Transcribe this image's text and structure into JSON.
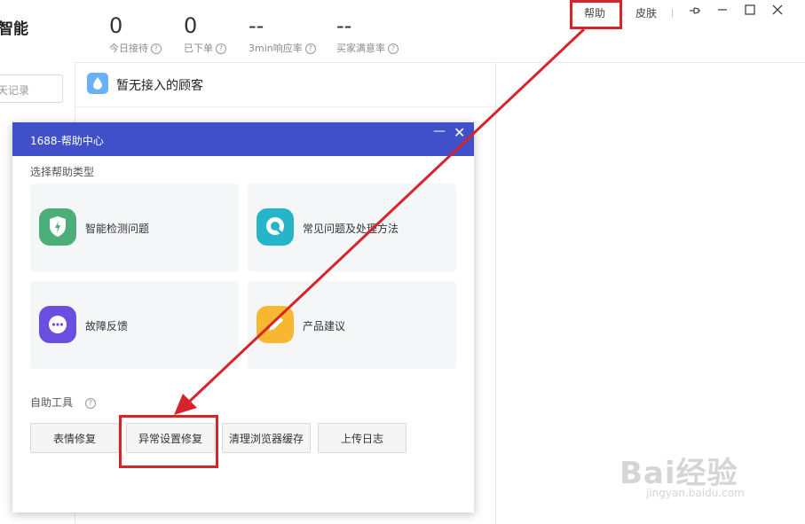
{
  "app": {
    "brand_partial": "智能"
  },
  "stats": [
    {
      "value": "0",
      "label": "今日接待"
    },
    {
      "value": "0",
      "label": "已下单"
    },
    {
      "value": "--",
      "label": "3min响应率"
    },
    {
      "value": "--",
      "label": "买家满意率"
    }
  ],
  "toolbar": {
    "help_label": "帮助",
    "skin_label": "皮肤"
  },
  "left": {
    "search_partial": "天记录"
  },
  "middle": {
    "no_guest_text": "暂无接入的顾客"
  },
  "dialog": {
    "title": "1688-帮助中心",
    "section_help_type": "选择帮助类型",
    "cards": [
      {
        "label": "智能检测问题",
        "icon": "shield-icon",
        "color": "#4caf7a"
      },
      {
        "label": "常见问题及处理方法",
        "icon": "q-icon",
        "color": "#25b4c8"
      },
      {
        "label": "故障反馈",
        "icon": "chat-icon",
        "color": "#6a4ee0"
      },
      {
        "label": "产品建议",
        "icon": "pencil-icon",
        "color": "#f7b731"
      }
    ],
    "section_tools": "自助工具",
    "tools": [
      "表情修复",
      "异常设置修复",
      "清理浏览器缓存",
      "上传日志"
    ]
  },
  "watermark": {
    "main": "Bai经验",
    "sub": "jingyan.baidu.com"
  },
  "colors": {
    "dialog_header": "#4050c8",
    "annotation": "#d6252a"
  }
}
